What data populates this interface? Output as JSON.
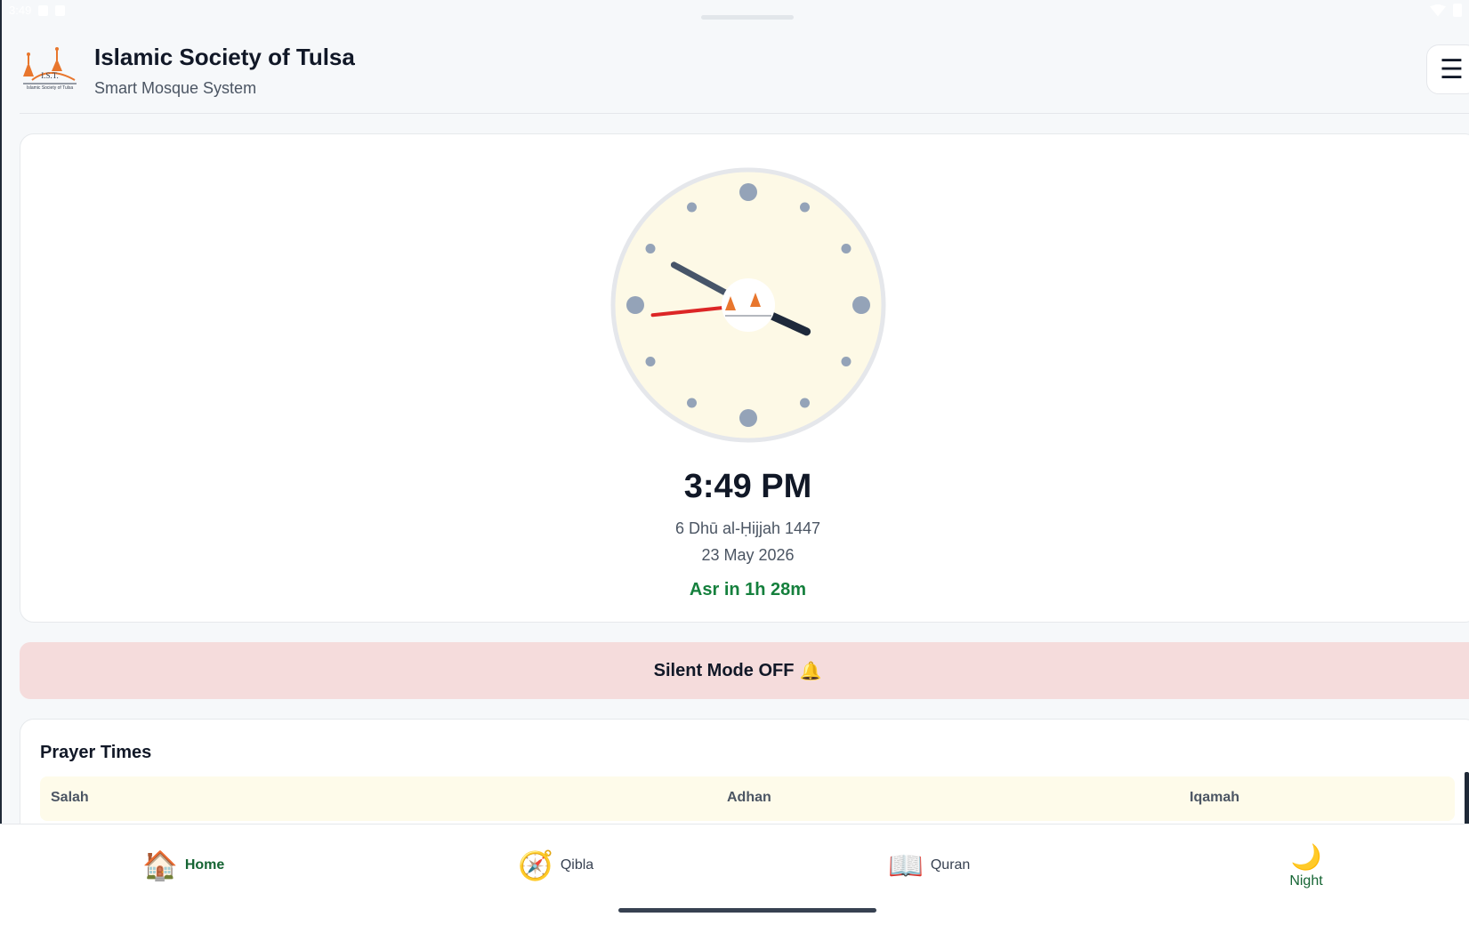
{
  "status_bar": {
    "time": "3:49"
  },
  "header": {
    "title": "Islamic Society of Tulsa",
    "subtitle": "Smart Mosque System",
    "logo_text": "I.S.T.",
    "logo_caption": "Islamic Society of Tulsa",
    "menu_icon": "hamburger-icon",
    "menu_glyph": "☰"
  },
  "clock": {
    "time": "3:49 PM",
    "hijri_date": "6 Dhū al-Ḥijjah 1447",
    "gregorian_date": "23 May 2026",
    "next_prayer": "Asr in 1h 28m",
    "hour": 3,
    "minute": 49,
    "second": 44,
    "face_color": "#fdf9e6",
    "rim_color": "#e5e7eb",
    "marker_color": "#94a3b8",
    "hour_hand_color": "#1e293b",
    "minute_hand_color": "#475569",
    "second_hand_color": "#dc2626"
  },
  "silent_mode": {
    "label": "Silent Mode OFF",
    "icon": "bell-icon",
    "glyph": "🔔"
  },
  "prayer_times": {
    "title": "Prayer Times",
    "columns": [
      "Salah",
      "Adhan",
      "Iqamah"
    ]
  },
  "nav": {
    "items": [
      {
        "label": "Home",
        "icon": "house-icon",
        "glyph": "🏠",
        "active": true
      },
      {
        "label": "Qibla",
        "icon": "compass-icon",
        "glyph": "🧭",
        "active": false
      },
      {
        "label": "Quran",
        "icon": "book-icon",
        "glyph": "📖",
        "active": false
      },
      {
        "label": "Night",
        "icon": "moon-icon",
        "glyph": "🌙",
        "active": false
      }
    ]
  },
  "colors": {
    "accent": "#15803d",
    "silent_bg": "#f5dcdc",
    "table_header_bg": "#fefbea",
    "logo_orange": "#e8762d"
  }
}
